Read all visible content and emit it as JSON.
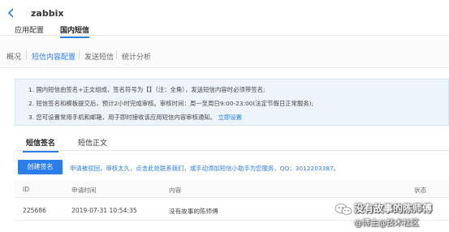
{
  "header": {
    "back_icon": "chevron-left-icon",
    "title": "zabbix",
    "tabs": [
      {
        "label": "应用配置",
        "active": false
      },
      {
        "label": "国内短信",
        "active": true
      }
    ]
  },
  "subnav": {
    "items": [
      {
        "label": "概况",
        "active": false
      },
      {
        "label": "短信内容配置",
        "active": true
      },
      {
        "label": "发送短信",
        "active": false
      },
      {
        "label": "统计分析",
        "active": false
      }
    ]
  },
  "notice": {
    "line1": "1. 国内短信由签名+正文组成，签名符号为【】（注：全角），发送短信内容时必须带签名;",
    "line2": "2. 短信签名和模板提交后，预计2小时完成审核。审核时间：周一至周日9:00-23:00(法定节假日正常服务);",
    "line3_text": "3. 您可设置常用手机和邮箱，用于即时接收该应用短信内容审核通知。",
    "line3_link": "立即设置"
  },
  "content_tabs": [
    {
      "label": "短信签名",
      "active": true
    },
    {
      "label": "短信正文",
      "active": false
    }
  ],
  "create_button": "创建签名",
  "tip": "申请被驳回，审核太久，点击此处联系我们，或手动添加短信小助手为您服务，QQ：3012203387。",
  "table": {
    "columns": [
      "ID",
      "申请时间",
      "内容",
      "状态"
    ],
    "rows": [
      {
        "id": "225686",
        "time": "2019-07-31 10:54:35",
        "content": "没有故事的陈师傅",
        "status": ""
      }
    ]
  },
  "watermark": {
    "line1": "没有故事的陈师傅",
    "line2": "@博主@技术社区"
  },
  "colors": {
    "accent": "#2b7de9",
    "notice_bg": "#eef4fb"
  }
}
